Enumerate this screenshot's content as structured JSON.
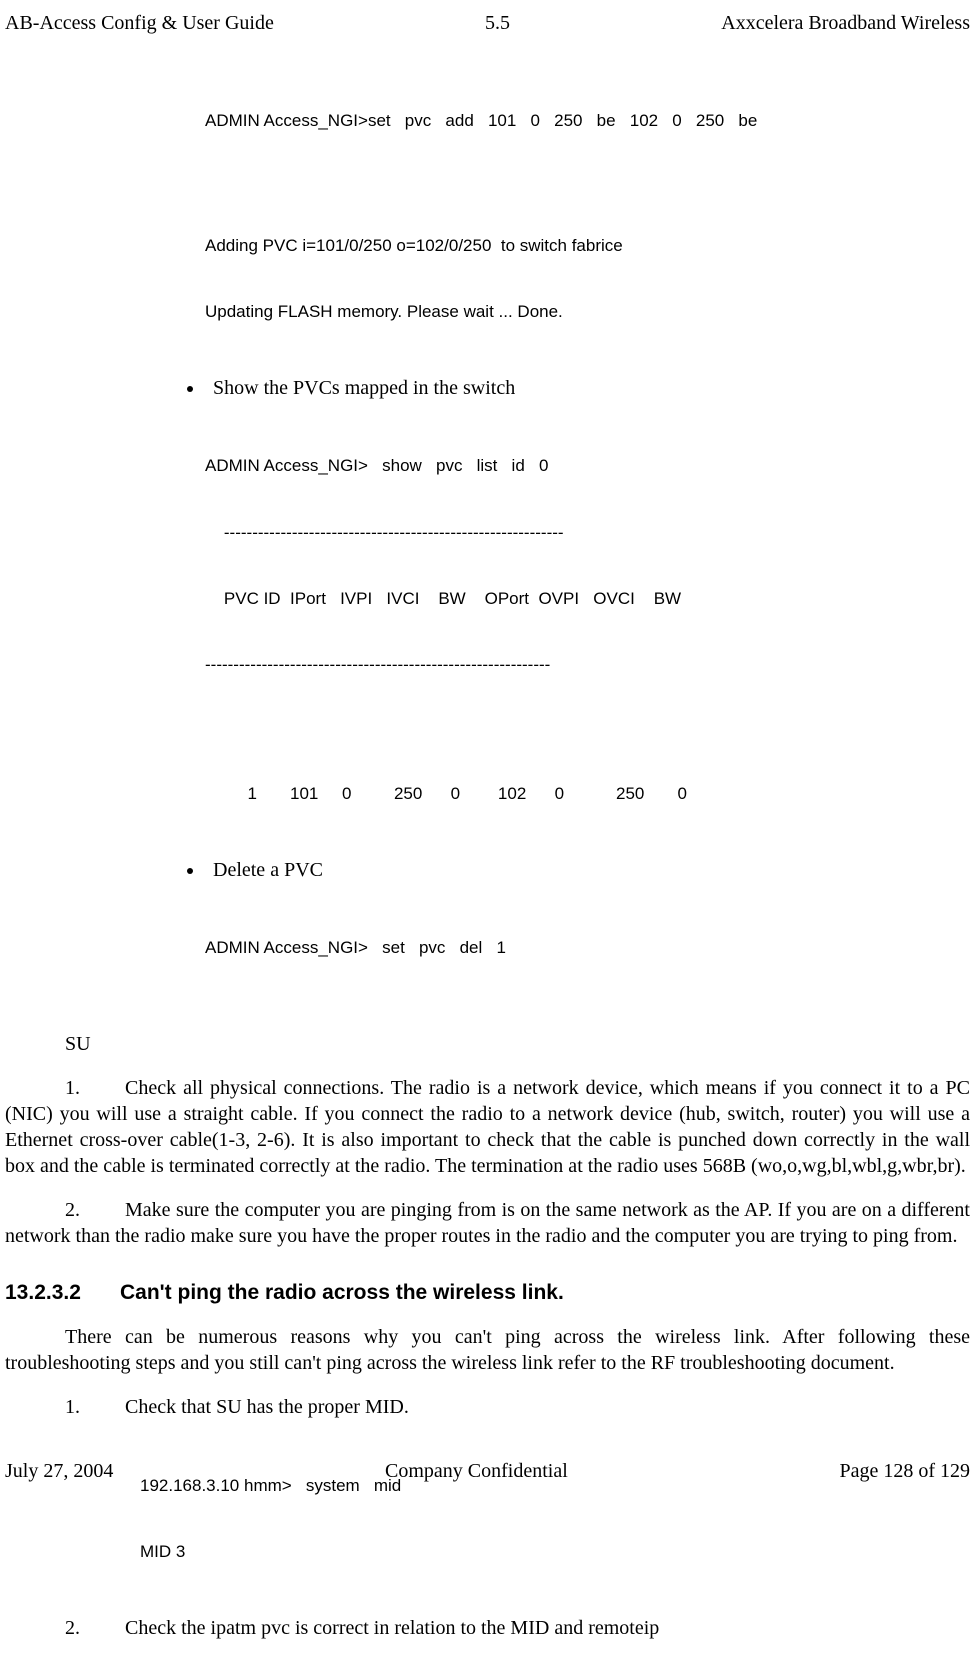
{
  "header": {
    "left": "AB-Access Config & User Guide",
    "center": "5.5",
    "right": "Axxcelera Broadband Wireless"
  },
  "code1": {
    "line1": "ADMIN Access_NGI>set   pvc   add   101   0   250   be   102   0   250   be",
    "line2": "Adding PVC i=101/0/250 o=102/0/250  to switch fabrice",
    "line3": "Updating FLASH memory. Please wait ... Done."
  },
  "bullets": {
    "b1": "Show the PVCs mapped in the switch",
    "b1_code_l1": "ADMIN Access_NGI>   show   pvc   list   id   0",
    "b1_code_l2": "    ------------------------------------------------------------",
    "b1_code_l3": "    PVC ID  IPort   IVPI   IVCI    BW    OPort  OVPI   OVCI    BW",
    "b1_code_l4": "-------------------------------------------------------------",
    "b1_code_l5": "         1       101     0         250      0        102      0           250       0",
    "b2": "Delete a PVC",
    "b2_code": "ADMIN Access_NGI>   set   pvc   del   1"
  },
  "su_label": "SU",
  "para1": {
    "num": "1.",
    "text": "Check all physical connections. The radio is a network device, which means if you connect it to a PC (NIC) you will use a straight cable. If you connect the radio to a network device (hub, switch, router) you will use a Ethernet cross-over cable(1-3, 2-6). It is also important to check that the cable is punched down correctly in the wall box and the cable is terminated correctly at the radio.  The termination at the radio uses 568B (wo,o,wg,bl,wbl,g,wbr,br)."
  },
  "para2": {
    "num": "2.",
    "text": "Make sure the computer you are pinging from is on the same network as the AP. If you are on a different network than the radio make sure you have the proper routes in the radio and the computer you are trying to ping from."
  },
  "heading": {
    "num": "13.2.3.2",
    "text": "Can't ping the radio across the wireless link."
  },
  "para3": "There can be numerous reasons why you can't ping across the wireless link. After following these troubleshooting steps and you still can't ping across the wireless link refer to the RF troubleshooting document.",
  "item1": {
    "num": "1.",
    "text": "Check that SU has the proper MID.",
    "code_l1": "192.168.3.10 hmm>   system   mid",
    "code_l2": "MID 3"
  },
  "item2": {
    "num": "2.",
    "text": "Check the ipatm pvc is correct in relation to the MID and remoteip"
  },
  "footer": {
    "left": "July 27, 2004",
    "center": "Company Confidential",
    "right": "Page 128 of 129"
  }
}
